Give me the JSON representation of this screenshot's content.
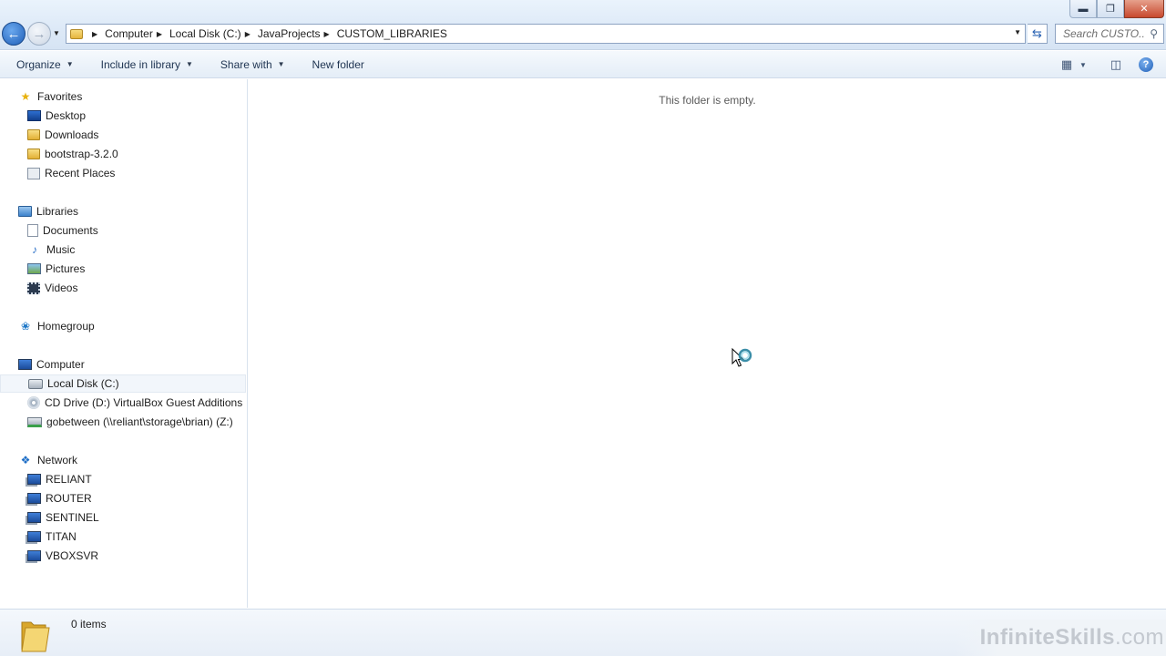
{
  "window": {
    "controls": {
      "minimize": "▬",
      "maximize": "❐",
      "close": "✕"
    }
  },
  "address_bar": {
    "crumbs": [
      "Computer",
      "Local Disk (C:)",
      "JavaProjects",
      "CUSTOM_LIBRARIES"
    ],
    "search_placeholder": "Search CUSTO..."
  },
  "toolbar": {
    "organize": "Organize",
    "include_in_library": "Include in library",
    "share_with": "Share with",
    "new_folder": "New folder"
  },
  "nav_pane": {
    "favorites": {
      "label": "Favorites",
      "items": [
        "Desktop",
        "Downloads",
        "bootstrap-3.2.0",
        "Recent Places"
      ]
    },
    "libraries": {
      "label": "Libraries",
      "items": [
        "Documents",
        "Music",
        "Pictures",
        "Videos"
      ]
    },
    "homegroup": {
      "label": "Homegroup"
    },
    "computer": {
      "label": "Computer",
      "items": [
        "Local Disk (C:)",
        "CD Drive (D:) VirtualBox Guest Additions",
        "gobetween (\\\\reliant\\storage\\brian) (Z:)"
      ],
      "selected_index": 0
    },
    "network": {
      "label": "Network",
      "items": [
        "RELIANT",
        "ROUTER",
        "SENTINEL",
        "TITAN",
        "VBOXSVR"
      ]
    }
  },
  "content": {
    "empty_message": "This folder is empty."
  },
  "details_pane": {
    "item_count": "0 items"
  },
  "watermark": {
    "brand": "InfiniteSkills",
    "suffix": ".com"
  },
  "colors": {
    "accent": "#1f5fb8",
    "selection_bg": "#f2f6fb",
    "chrome_bg": "#dde9f7"
  }
}
